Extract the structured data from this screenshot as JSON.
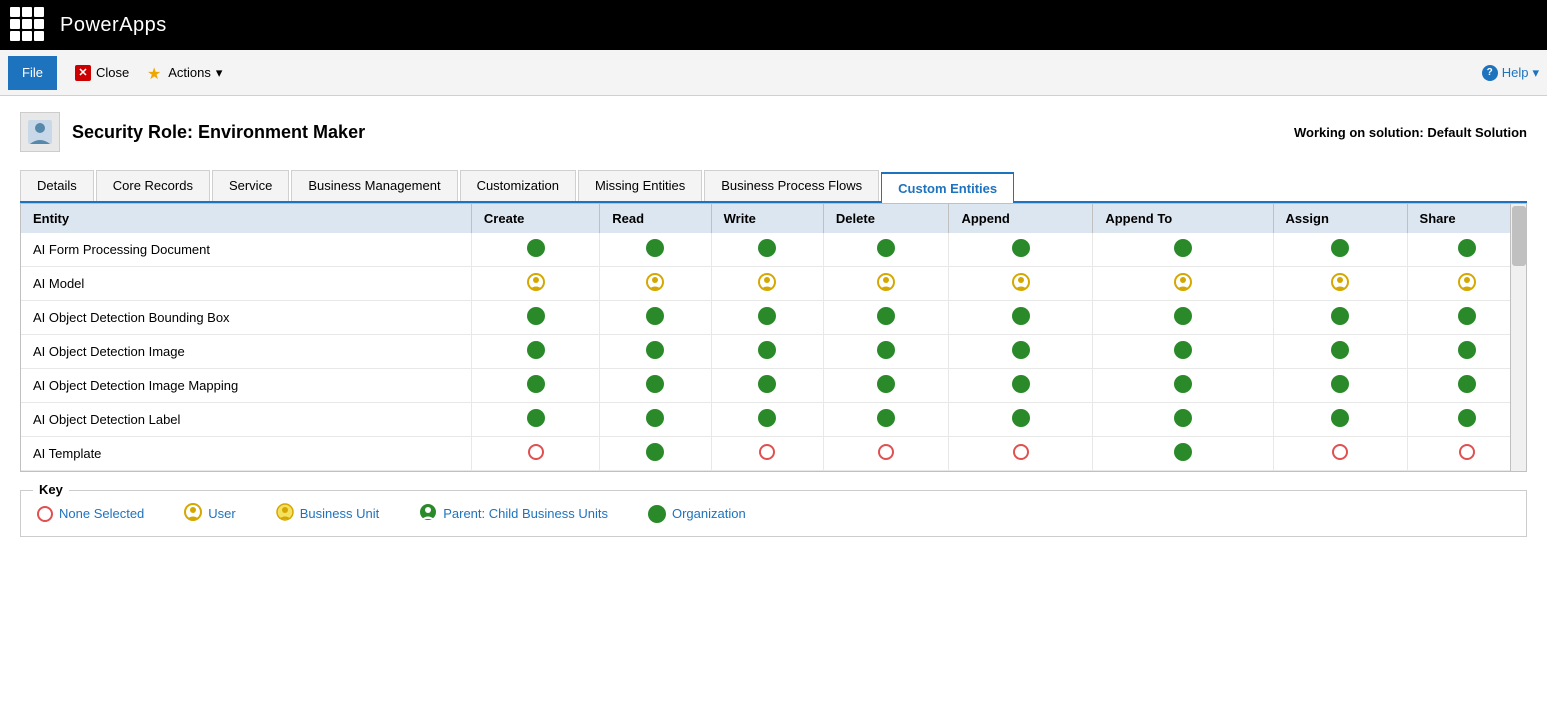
{
  "topbar": {
    "app_title": "PowerApps"
  },
  "toolbar": {
    "file_label": "File",
    "close_label": "Close",
    "actions_label": "Actions",
    "help_label": "Help"
  },
  "page": {
    "title": "Security Role: Environment Maker",
    "solution_info": "Working on solution: Default Solution"
  },
  "tabs": [
    {
      "id": "details",
      "label": "Details",
      "active": false
    },
    {
      "id": "core-records",
      "label": "Core Records",
      "active": false
    },
    {
      "id": "service",
      "label": "Service",
      "active": false
    },
    {
      "id": "business-management",
      "label": "Business Management",
      "active": false
    },
    {
      "id": "customization",
      "label": "Customization",
      "active": false
    },
    {
      "id": "missing-entities",
      "label": "Missing Entities",
      "active": false
    },
    {
      "id": "business-process-flows",
      "label": "Business Process Flows",
      "active": false
    },
    {
      "id": "custom-entities",
      "label": "Custom Entities",
      "active": true
    }
  ],
  "table": {
    "columns": [
      "Entity",
      "Create",
      "Read",
      "Write",
      "Delete",
      "Append",
      "Append To",
      "Assign",
      "Share"
    ],
    "rows": [
      {
        "entity": "AI Form Processing Document",
        "create": "green",
        "read": "green",
        "write": "green",
        "delete": "green",
        "append": "green",
        "append_to": "green",
        "assign": "green",
        "share": "green"
      },
      {
        "entity": "AI Model",
        "create": "user",
        "read": "user",
        "write": "user",
        "delete": "user",
        "append": "user",
        "append_to": "user",
        "assign": "user",
        "share": "user"
      },
      {
        "entity": "AI Object Detection Bounding Box",
        "create": "green",
        "read": "green",
        "write": "green",
        "delete": "green",
        "append": "green",
        "append_to": "green",
        "assign": "green",
        "share": "green"
      },
      {
        "entity": "AI Object Detection Image",
        "create": "green",
        "read": "green",
        "write": "green",
        "delete": "green",
        "append": "green",
        "append_to": "green",
        "assign": "green",
        "share": "green"
      },
      {
        "entity": "AI Object Detection Image Mapping",
        "create": "green",
        "read": "green",
        "write": "green",
        "delete": "green",
        "append": "green",
        "append_to": "green",
        "assign": "green",
        "share": "green"
      },
      {
        "entity": "AI Object Detection Label",
        "create": "green",
        "read": "green",
        "write": "green",
        "delete": "green",
        "append": "green",
        "append_to": "green",
        "assign": "green",
        "share": "green"
      },
      {
        "entity": "AI Template",
        "create": "none",
        "read": "green",
        "write": "none",
        "delete": "none",
        "append": "none",
        "append_to": "green",
        "assign": "none",
        "share": "none"
      }
    ]
  },
  "key": {
    "title": "Key",
    "items": [
      {
        "id": "none",
        "label": "None Selected",
        "type": "none"
      },
      {
        "id": "user",
        "label": "User",
        "type": "user"
      },
      {
        "id": "business-unit",
        "label": "Business Unit",
        "type": "business-unit"
      },
      {
        "id": "parent",
        "label": "Parent: Child Business Units",
        "type": "parent"
      },
      {
        "id": "organization",
        "label": "Organization",
        "type": "organization"
      }
    ]
  }
}
